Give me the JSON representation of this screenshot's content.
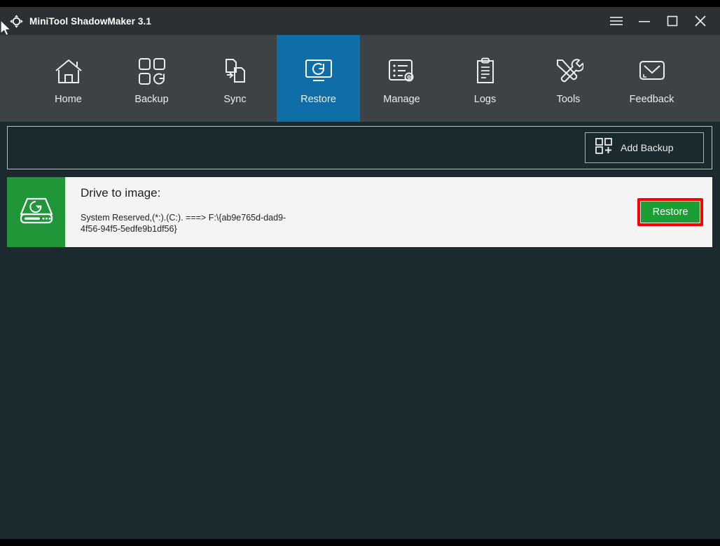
{
  "window": {
    "title": "MiniTool ShadowMaker 3.1",
    "logo_icon": "move-arrows-icon",
    "controls": [
      {
        "name": "menu-button",
        "icon": "hamburger-menu-icon",
        "label": "Menu"
      },
      {
        "name": "minimize-button",
        "icon": "minimize-icon",
        "label": "Minimize"
      },
      {
        "name": "maximize-button",
        "icon": "maximize-icon",
        "label": "Maximize"
      },
      {
        "name": "close-button",
        "icon": "close-icon",
        "label": "Close"
      }
    ]
  },
  "nav": {
    "active": "Restore",
    "active_color": "#0f6ea7",
    "items": [
      {
        "label": "Home",
        "icon": "home-icon"
      },
      {
        "label": "Backup",
        "icon": "backup-squares-icon"
      },
      {
        "label": "Sync",
        "icon": "sync-files-icon"
      },
      {
        "label": "Restore",
        "icon": "restore-monitor-icon"
      },
      {
        "label": "Manage",
        "icon": "manage-list-gear-icon"
      },
      {
        "label": "Logs",
        "icon": "logs-clipboard-icon"
      },
      {
        "label": "Tools",
        "icon": "tools-wrench-screwdriver-icon"
      },
      {
        "label": "Feedback",
        "icon": "feedback-envelope-icon"
      }
    ]
  },
  "toolbar": {
    "add_backup_label": "Add Backup",
    "add_backup_icon": "add-backup-squares-plus-icon"
  },
  "backup_card": {
    "thumb_icon": "hard-drive-icon",
    "thumb_color": "#219639",
    "title": "Drive to image:",
    "description": " System Reserved,(*:).(C:). ===> F:\\{ab9e765d-dad9-4f56-94f5-5edfe9b1df56}",
    "restore_label": "Restore",
    "restore_color": "#1d9e35",
    "highlight_color": "#ff0000"
  }
}
